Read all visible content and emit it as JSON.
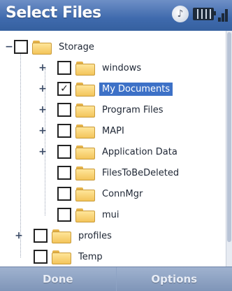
{
  "window": {
    "title": "Select Files"
  },
  "status_icons": [
    "speaker-icon",
    "battery-icon",
    "signal-icon"
  ],
  "tree": {
    "items": [
      {
        "label": "Storage",
        "checked": false,
        "expander": "−"
      },
      {
        "label": "windows",
        "checked": false,
        "expander": "+"
      },
      {
        "label": "My Documents",
        "checked": true,
        "expander": "+",
        "selected": true
      },
      {
        "label": "Program Files",
        "checked": false,
        "expander": "+"
      },
      {
        "label": "MAPI",
        "checked": false,
        "expander": "+"
      },
      {
        "label": "Application Data",
        "checked": false,
        "expander": "+"
      },
      {
        "label": "FilesToBeDeleted",
        "checked": false,
        "expander": ""
      },
      {
        "label": "ConnMgr",
        "checked": false,
        "expander": ""
      },
      {
        "label": "mui",
        "checked": false,
        "expander": ""
      },
      {
        "label": "profiles",
        "checked": false,
        "expander": "+"
      },
      {
        "label": "Temp",
        "checked": false,
        "expander": ""
      }
    ]
  },
  "softkeys": {
    "left": "Done",
    "right": "Options"
  },
  "colors": {
    "titlebar": "#3f6aad",
    "selection": "#3d71c7",
    "folder": "#f3c55b"
  }
}
